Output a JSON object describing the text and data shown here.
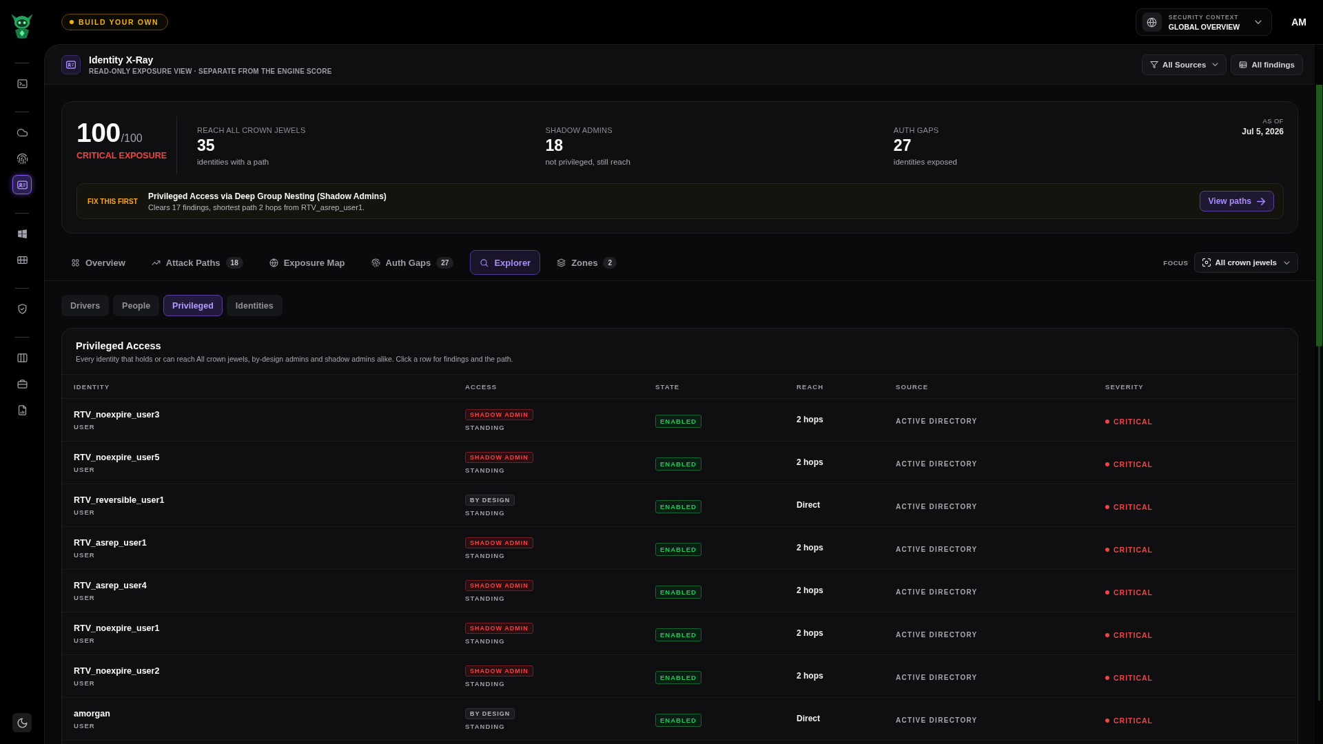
{
  "sidebar": {
    "groups": [
      {
        "items": [
          {
            "kind": "terminal",
            "selected": false
          }
        ]
      },
      {
        "items": [
          {
            "kind": "cloud",
            "selected": false
          },
          {
            "kind": "fingerprint",
            "selected": false
          },
          {
            "kind": "identity",
            "selected": true
          }
        ]
      },
      {
        "items": [
          {
            "kind": "windows",
            "selected": false
          },
          {
            "kind": "grid",
            "selected": false
          }
        ]
      },
      {
        "items": [
          {
            "kind": "shield",
            "selected": false
          }
        ]
      },
      {
        "items": [
          {
            "kind": "columns",
            "selected": false
          },
          {
            "kind": "briefcase",
            "selected": false
          },
          {
            "kind": "report",
            "selected": false
          }
        ]
      }
    ]
  },
  "top_bar": {
    "badge": "BUILD YOUR OWN",
    "context": {
      "label": "SECURITY CONTEXT",
      "value": "GLOBAL OVERVIEW"
    },
    "user_initials": "AM"
  },
  "page_header": {
    "title": "Identity X-Ray",
    "subtitle": "READ-ONLY EXPOSURE VIEW · SEPARATE FROM THE ENGINE SCORE",
    "filters": [
      {
        "label": "All Sources",
        "kind": "dropdown"
      },
      {
        "label": "All findings",
        "kind": "link"
      }
    ]
  },
  "summary": {
    "score": {
      "value": "100",
      "max": "/100",
      "label": "CRITICAL EXPOSURE"
    },
    "stats": [
      {
        "label": "REACH ALL CROWN JEWELS",
        "value": "35",
        "caption": "identities with a path"
      },
      {
        "label": "SHADOW ADMINS",
        "value": "18",
        "caption": "not privileged, still reach"
      },
      {
        "label": "AUTH GAPS",
        "value": "27",
        "caption": "identities exposed"
      }
    ],
    "as_of": {
      "label": "AS OF",
      "date": "Jul 5, 2026"
    },
    "fix_first": {
      "label": "FIX THIS FIRST",
      "title": "Privileged Access via Deep Group Nesting (Shadow Admins)",
      "detail": "Clears 17 findings, shortest path 2 hops from RTV_asrep_user1.",
      "button": "View paths"
    }
  },
  "tabs": [
    {
      "label": "Overview",
      "kind": "overview",
      "selected": false
    },
    {
      "label": "Attack Paths",
      "kind": "paths",
      "count": "18",
      "selected": false
    },
    {
      "label": "Exposure Map",
      "kind": "map",
      "selected": false
    },
    {
      "label": "Auth Gaps",
      "kind": "gaps",
      "count": "27",
      "selected": false
    },
    {
      "label": "Explorer",
      "kind": "explorer",
      "selected": true
    },
    {
      "label": "Zones",
      "kind": "zones",
      "count": "2",
      "selected": false
    }
  ],
  "focus": {
    "label": "FOCUS",
    "value": "All crown jewels"
  },
  "subtabs": [
    {
      "label": "Drivers",
      "selected": false
    },
    {
      "label": "People",
      "selected": false
    },
    {
      "label": "Privileged",
      "selected": true
    },
    {
      "label": "Identities",
      "selected": false
    }
  ],
  "table": {
    "title": "Privileged Access",
    "description": "Every identity that holds or can reach All crown jewels, by-design admins and shadow admins alike. Click a row for findings and the path.",
    "columns": [
      "IDENTITY",
      "ACCESS",
      "STATE",
      "REACH",
      "SOURCE",
      "SEVERITY"
    ],
    "rows": [
      {
        "identity": "RTV_noexpire_user3",
        "type": "USER",
        "access": {
          "label": "SHADOW ADMIN",
          "kind": "danger"
        },
        "mode": "STANDING",
        "state": "ENABLED",
        "reach": "2 hops",
        "source": "ACTIVE DIRECTORY",
        "severity": {
          "label": "CRITICAL",
          "color": "#ef4444"
        }
      },
      {
        "identity": "RTV_noexpire_user5",
        "type": "USER",
        "access": {
          "label": "SHADOW ADMIN",
          "kind": "danger"
        },
        "mode": "STANDING",
        "state": "ENABLED",
        "reach": "2 hops",
        "source": "ACTIVE DIRECTORY",
        "severity": {
          "label": "CRITICAL",
          "color": "#ef4444"
        }
      },
      {
        "identity": "RTV_reversible_user1",
        "type": "USER",
        "access": {
          "label": "BY DESIGN",
          "kind": "neutral"
        },
        "mode": "STANDING",
        "state": "ENABLED",
        "reach": "Direct",
        "source": "ACTIVE DIRECTORY",
        "severity": {
          "label": "CRITICAL",
          "color": "#ef4444"
        }
      },
      {
        "identity": "RTV_asrep_user1",
        "type": "USER",
        "access": {
          "label": "SHADOW ADMIN",
          "kind": "danger"
        },
        "mode": "STANDING",
        "state": "ENABLED",
        "reach": "2 hops",
        "source": "ACTIVE DIRECTORY",
        "severity": {
          "label": "CRITICAL",
          "color": "#ef4444"
        }
      },
      {
        "identity": "RTV_asrep_user4",
        "type": "USER",
        "access": {
          "label": "SHADOW ADMIN",
          "kind": "danger"
        },
        "mode": "STANDING",
        "state": "ENABLED",
        "reach": "2 hops",
        "source": "ACTIVE DIRECTORY",
        "severity": {
          "label": "CRITICAL",
          "color": "#ef4444"
        }
      },
      {
        "identity": "RTV_noexpire_user1",
        "type": "USER",
        "access": {
          "label": "SHADOW ADMIN",
          "kind": "danger"
        },
        "mode": "STANDING",
        "state": "ENABLED",
        "reach": "2 hops",
        "source": "ACTIVE DIRECTORY",
        "severity": {
          "label": "CRITICAL",
          "color": "#ef4444"
        }
      },
      {
        "identity": "RTV_noexpire_user2",
        "type": "USER",
        "access": {
          "label": "SHADOW ADMIN",
          "kind": "danger"
        },
        "mode": "STANDING",
        "state": "ENABLED",
        "reach": "2 hops",
        "source": "ACTIVE DIRECTORY",
        "severity": {
          "label": "CRITICAL",
          "color": "#ef4444"
        }
      },
      {
        "identity": "amorgan",
        "type": "USER",
        "access": {
          "label": "BY DESIGN",
          "kind": "neutral"
        },
        "mode": "STANDING",
        "state": "ENABLED",
        "reach": "Direct",
        "source": "ACTIVE DIRECTORY",
        "severity": {
          "label": "CRITICAL",
          "color": "#ef4444"
        }
      }
    ]
  }
}
